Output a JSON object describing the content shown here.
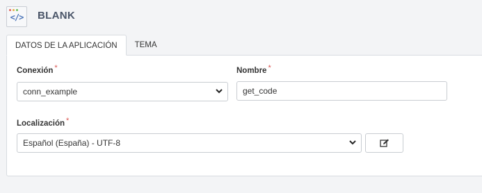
{
  "app": {
    "title": "BLANK",
    "icon": "code-icon",
    "icon_glyph": "</>"
  },
  "tabs": [
    {
      "label": "DATOS DE LA APLICACIÓN",
      "active": true
    },
    {
      "label": "TEMA",
      "active": false
    }
  ],
  "form": {
    "connection": {
      "label": "Conexión",
      "required_mark": "*",
      "value": "conn_example"
    },
    "name": {
      "label": "Nombre",
      "required_mark": "*",
      "value": "get_code"
    },
    "locale": {
      "label": "Localización",
      "required_mark": "*",
      "value": "Español (España) - UTF-8"
    },
    "edit_button_icon": "edit-icon"
  },
  "colors": {
    "accent": "#4a74b8",
    "required": "#d9534f",
    "title": "#4a5568"
  }
}
